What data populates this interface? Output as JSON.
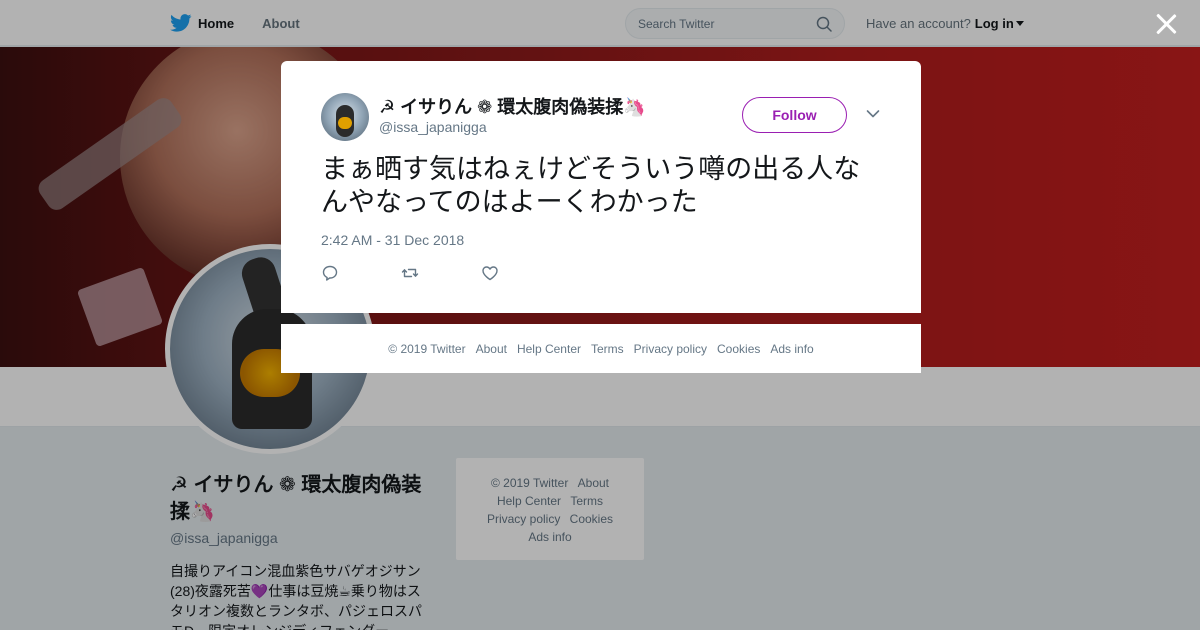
{
  "nav": {
    "home_label": "Home",
    "about_label": "About",
    "search_placeholder": "Search Twitter",
    "account_prompt": "Have an account?",
    "login_label": "Log in"
  },
  "profile": {
    "name": "☭ イサりん ❁ 環太腹肉偽装揉🦄",
    "handle": "@issa_japanigga",
    "bio": "自撮りアイコン混血紫色サバゲオジサン(28)夜露死苦💜仕事は豆焼☕乗り物はスタリオン複数とランタボ、パジェロスパモD、限定オレンジディフェンダー"
  },
  "side_footer": {
    "copyright": "© 2019 Twitter",
    "about": "About",
    "help": "Help Center",
    "terms": "Terms",
    "privacy": "Privacy policy",
    "cookies": "Cookies",
    "ads": "Ads info"
  },
  "tweet": {
    "author_name": "☭ イサりん ❁ 環太腹肉偽装揉🦄",
    "author_handle": "@issa_japanigga",
    "follow_label": "Follow",
    "text": "まぁ晒す気はねぇけどそういう噂の出る人なんやなってのはよーくわかった",
    "timestamp": "2:42 AM - 31 Dec 2018"
  },
  "modal_footer": {
    "copyright": "© 2019 Twitter",
    "about": "About",
    "help": "Help Center",
    "terms": "Terms",
    "privacy": "Privacy policy",
    "cookies": "Cookies",
    "ads": "Ads info"
  },
  "colors": {
    "twitter_blue": "#1da1f2",
    "follow_accent": "#9a1fb2",
    "overlay": "rgba(0,0,0,0.3)"
  },
  "icons": [
    "twitter-bird-icon",
    "search-icon",
    "caret-down-icon",
    "close-icon",
    "chevron-down-icon",
    "reply-icon",
    "retweet-icon",
    "like-icon"
  ]
}
